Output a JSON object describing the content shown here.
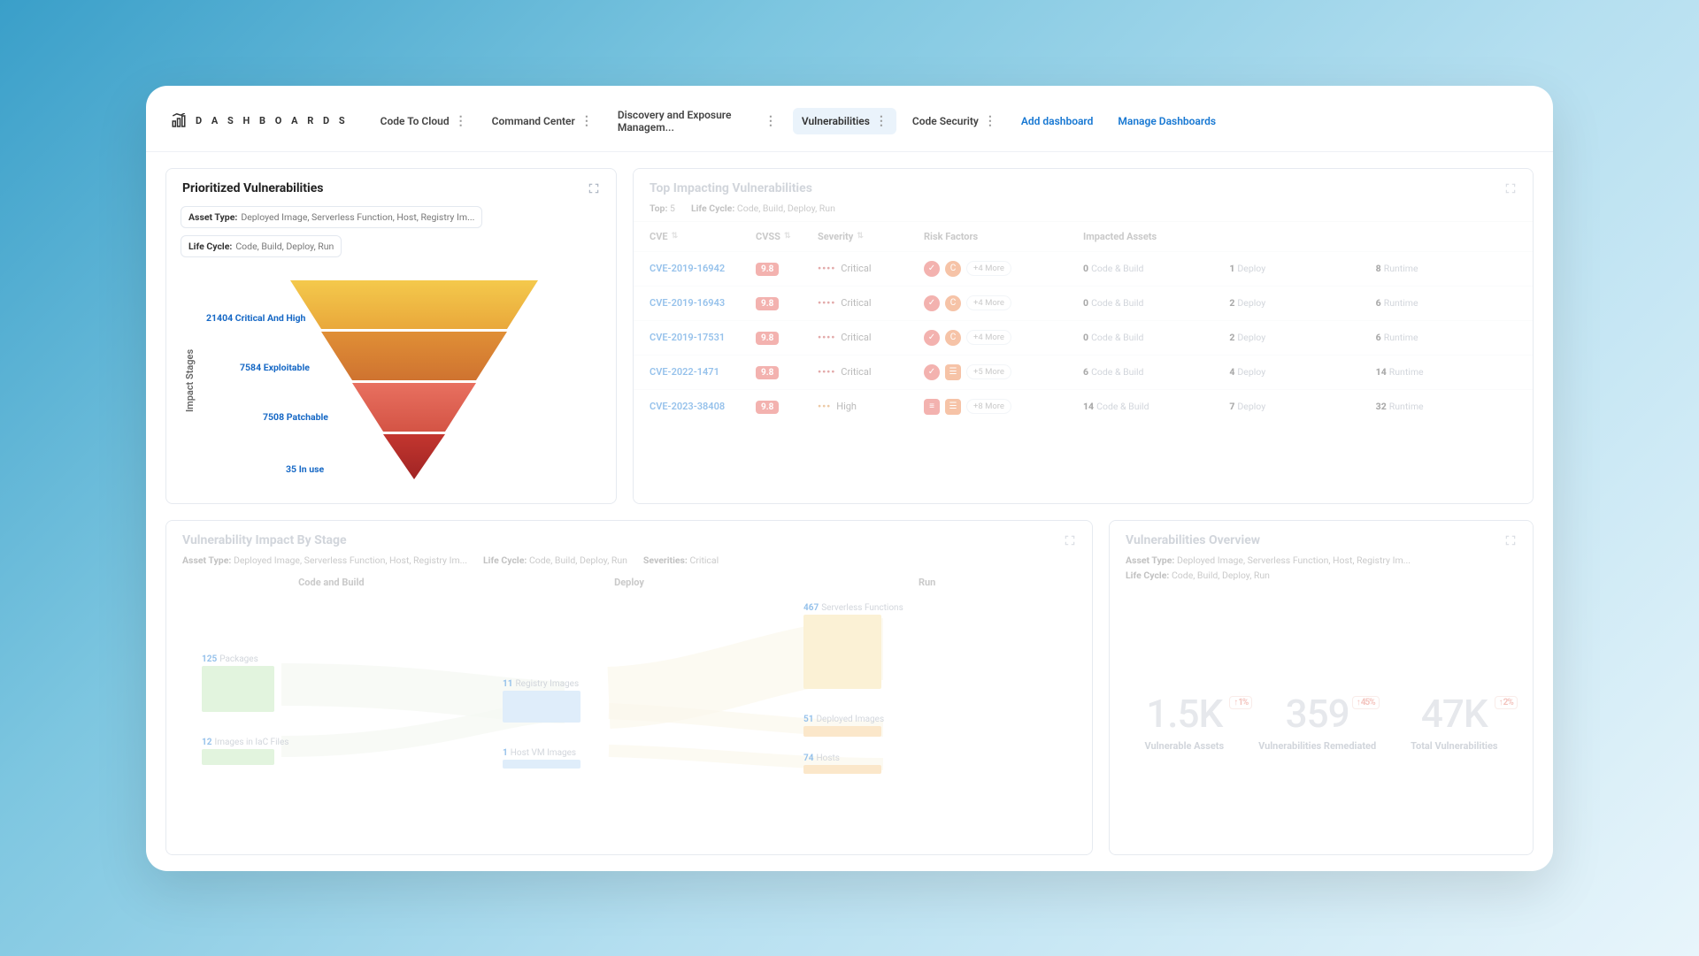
{
  "brand": "D A S H B O A R D S",
  "tabs": [
    {
      "label": "Code To Cloud"
    },
    {
      "label": "Command Center"
    },
    {
      "label": "Discovery and Exposure Managem..."
    },
    {
      "label": "Vulnerabilities",
      "active": true
    },
    {
      "label": "Code Security"
    }
  ],
  "links": {
    "add": "Add dashboard",
    "manage": "Manage Dashboards"
  },
  "funnel": {
    "title": "Prioritized Vulnerabilities",
    "chips": [
      {
        "k": "Asset Type:",
        "v": "Deployed Image, Serverless Function, Host, Registry Im..."
      },
      {
        "k": "Life Cycle:",
        "v": "Code, Build, Deploy, Run"
      }
    ],
    "yaxis": "Impact Stages",
    "labels": [
      {
        "n": "21404",
        "t": "Critical And High"
      },
      {
        "n": "7584",
        "t": "Exploitable"
      },
      {
        "n": "7508",
        "t": "Patchable"
      },
      {
        "n": "35",
        "t": "In use"
      }
    ]
  },
  "table": {
    "title": "Top Impacting Vulnerabilities",
    "filters": [
      {
        "k": "Top:",
        "v": "5"
      },
      {
        "k": "Life Cycle:",
        "v": "Code, Build, Deploy, Run"
      }
    ],
    "cols": [
      "CVE",
      "CVSS",
      "Severity",
      "Risk Factors",
      "Impacted Assets"
    ],
    "rows": [
      {
        "cve": "CVE-2019-16942",
        "cvss": "9.8",
        "sev": "Critical",
        "dots": 4,
        "ric": [
          "check",
          "c"
        ],
        "more": "+4 More",
        "imp": [
          [
            "0",
            "Code & Build"
          ],
          [
            "1",
            "Deploy"
          ],
          [
            "8",
            "Runtime"
          ]
        ]
      },
      {
        "cve": "CVE-2019-16943",
        "cvss": "9.8",
        "sev": "Critical",
        "dots": 4,
        "ric": [
          "check",
          "c"
        ],
        "more": "+4 More",
        "imp": [
          [
            "0",
            "Code & Build"
          ],
          [
            "2",
            "Deploy"
          ],
          [
            "6",
            "Runtime"
          ]
        ]
      },
      {
        "cve": "CVE-2019-17531",
        "cvss": "9.8",
        "sev": "Critical",
        "dots": 4,
        "ric": [
          "check",
          "c"
        ],
        "more": "+4 More",
        "imp": [
          [
            "0",
            "Code & Build"
          ],
          [
            "2",
            "Deploy"
          ],
          [
            "6",
            "Runtime"
          ]
        ]
      },
      {
        "cve": "CVE-2022-1471",
        "cvss": "9.8",
        "sev": "Critical",
        "dots": 4,
        "ric": [
          "check",
          "box"
        ],
        "more": "+5 More",
        "imp": [
          [
            "6",
            "Code & Build"
          ],
          [
            "4",
            "Deploy"
          ],
          [
            "14",
            "Runtime"
          ]
        ]
      },
      {
        "cve": "CVE-2023-38408",
        "cvss": "9.8",
        "sev": "High",
        "dots": 3,
        "ric": [
          "box2",
          "box"
        ],
        "more": "+8 More",
        "imp": [
          [
            "14",
            "Code & Build"
          ],
          [
            "7",
            "Deploy"
          ],
          [
            "32",
            "Runtime"
          ]
        ]
      }
    ]
  },
  "sankey": {
    "title": "Vulnerability Impact By Stage",
    "chips": [
      {
        "k": "Asset Type:",
        "v": "Deployed Image, Serverless Function, Host, Registry Im..."
      },
      {
        "k": "Life Cycle:",
        "v": "Code, Build, Deploy, Run"
      },
      {
        "k": "Severities:",
        "v": "Critical"
      }
    ],
    "stages": [
      "Code and Build",
      "Deploy",
      "Run"
    ],
    "nodes": {
      "packages": {
        "n": "125",
        "t": "Packages"
      },
      "iac": {
        "n": "12",
        "t": "Images in IaC Files"
      },
      "registry": {
        "n": "11",
        "t": "Registry Images"
      },
      "hostvm": {
        "n": "1",
        "t": "Host VM Images"
      },
      "serverless": {
        "n": "467",
        "t": "Serverless Functions"
      },
      "deployed": {
        "n": "51",
        "t": "Deployed Images"
      },
      "hosts": {
        "n": "74",
        "t": "Hosts"
      }
    }
  },
  "overview": {
    "title": "Vulnerabilities Overview",
    "chips": [
      {
        "k": "Asset Type:",
        "v": "Deployed Image, Serverless Function, Host, Registry Im..."
      },
      {
        "k": "Life Cycle:",
        "v": "Code, Build, Deploy, Run"
      }
    ],
    "kpis": [
      {
        "val": "1.5K",
        "delta": "1%",
        "lbl": "Vulnerable Assets"
      },
      {
        "val": "359",
        "delta": "45%",
        "lbl": "Vulnerabilities Remediated"
      },
      {
        "val": "47K",
        "delta": "2%",
        "lbl": "Total Vulnerabilities"
      }
    ]
  },
  "chart_data": {
    "type": "bar",
    "title": "Prioritized Vulnerabilities — Impact Stages funnel",
    "categories": [
      "Critical And High",
      "Exploitable",
      "Patchable",
      "In use"
    ],
    "values": [
      21404,
      7584,
      7508,
      35
    ],
    "xlabel": "",
    "ylabel": "Impact Stages"
  }
}
